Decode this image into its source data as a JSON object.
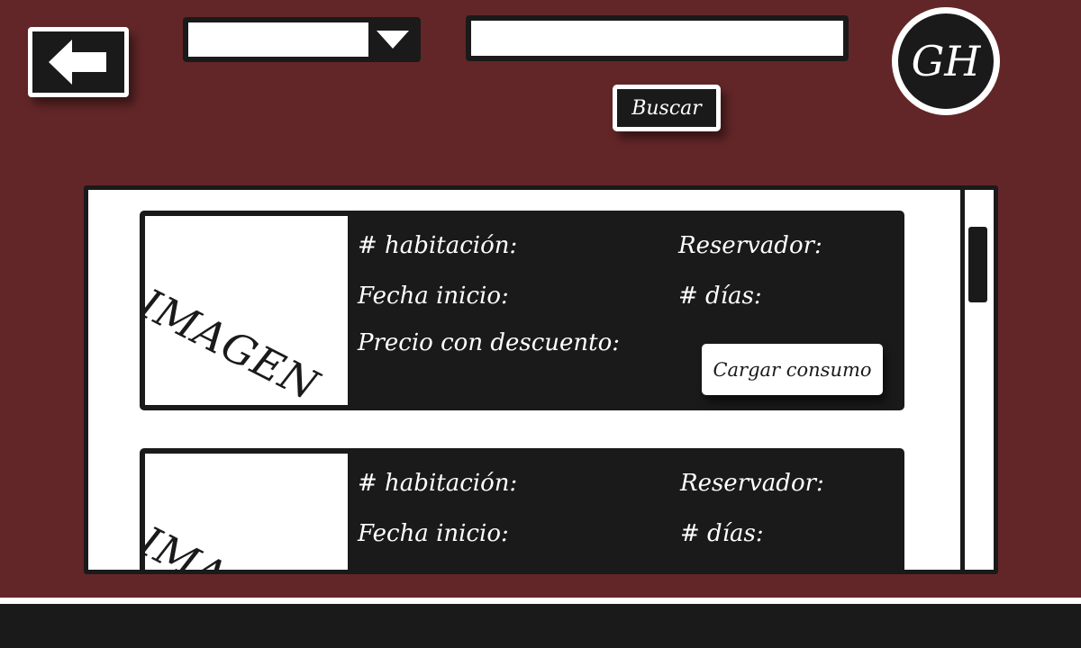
{
  "header": {
    "back_icon": "arrow-left-icon",
    "filter": {
      "selected": "",
      "arrow_icon": "caret-down-icon"
    },
    "search": {
      "value": "",
      "placeholder": "",
      "button_label": "Buscar"
    },
    "logo": {
      "text": "GH"
    }
  },
  "reservations": [
    {
      "image_label": "IMAGEN",
      "room_label": "# habitación:",
      "reserver_label": "Reservador:",
      "start_label": "Fecha inicio:",
      "days_label": "# días:",
      "price_label": "Precio con descuento:",
      "action_label": "Cargar consumo"
    },
    {
      "image_label": "IMAGEN",
      "room_label": "# habitación:",
      "reserver_label": "Reservador:",
      "start_label": "Fecha inicio:",
      "days_label": "# días:"
    }
  ],
  "colors": {
    "background": "#632628",
    "dark": "#1a1a1a",
    "light": "#ffffff"
  }
}
